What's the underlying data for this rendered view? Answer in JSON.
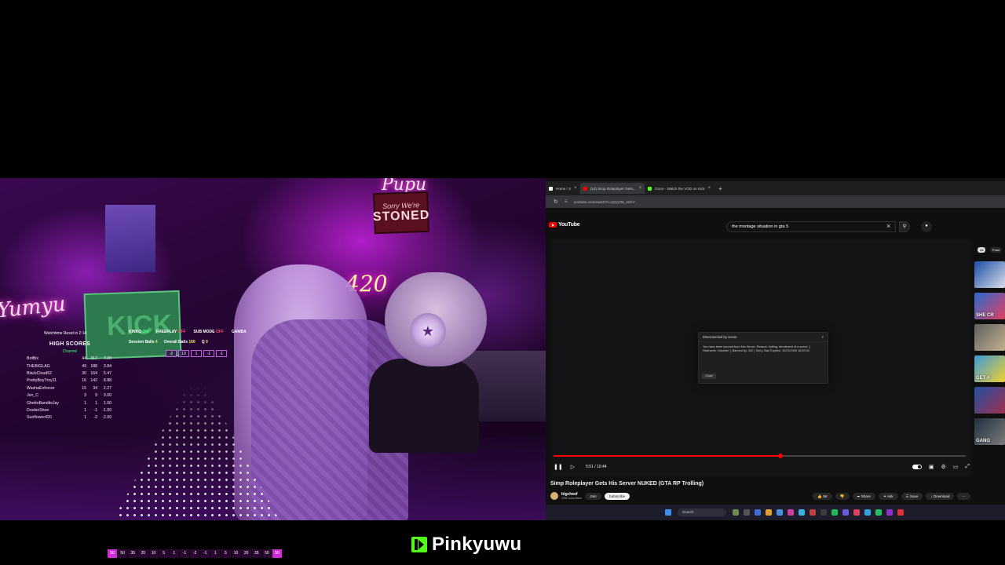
{
  "webcam": {
    "neon_left": "Yumyu",
    "neon_top": "Pupu",
    "neon_420": "420",
    "sign_stoned_top": "Sorry We're",
    "sign_stoned_main": "STONED",
    "kick_card": "KICK"
  },
  "scoreboard": {
    "reset_text": "Watchtime Reset in 2:14",
    "title": "HIGH SCORES",
    "channel": "Channel",
    "rows": [
      {
        "name": "BotBix",
        "a": "44",
        "b": "317",
        "c": "7.20"
      },
      {
        "name": "THEBIGLAG",
        "a": "49",
        "b": "188",
        "c": "3.84"
      },
      {
        "name": "BlackCloud52",
        "a": "30",
        "b": "164",
        "c": "5.47"
      },
      {
        "name": "PrettyBoyTroy11",
        "a": "16",
        "b": "142",
        "c": "8.88"
      },
      {
        "name": "WaxhaEnforcer",
        "a": "15",
        "b": "34",
        "c": "2.27"
      },
      {
        "name": "Jen_C",
        "a": "3",
        "b": "9",
        "c": "3.00"
      },
      {
        "name": "GhettoBanditsJay",
        "a": "1",
        "b": "1",
        "c": "1.00"
      },
      {
        "name": "DookieShoe",
        "a": "1",
        "b": "-1",
        "c": "-1.00"
      },
      {
        "name": "Sunflower420",
        "a": "1",
        "b": "-2",
        "c": "-2.00"
      }
    ]
  },
  "modes": {
    "kinko": "KINKO",
    "kinko_state": "ON",
    "freeplay": "FREEPLAY",
    "freeplay_state": "OFF",
    "submode": "SUB MODE",
    "submode_state": "OFF",
    "gamba": "GAMBA",
    "session_label": "Session Balls",
    "session_value": "4",
    "overall_label": "Overall Balls",
    "overall_value": "160",
    "q_label": "Q",
    "q_value": "0",
    "steps": [
      "-2",
      "10",
      "1",
      "-1",
      "-1"
    ]
  },
  "browser": {
    "tabs": [
      {
        "label": "Home / X",
        "color": "#ffffff"
      },
      {
        "label": "(14) Simp Roleplayer Gets...",
        "color": "#ff0000"
      },
      {
        "label": "Gooo - Watch the VOD on Kick",
        "color": "#53fc18"
      }
    ],
    "url": "youtube.com/watch?v=QGgY5I_4UhY",
    "yt_logo": "YouTube",
    "search_value": "the montage situation in gta 5",
    "ban_dialog": {
      "title": "Disconnected by server",
      "body": "You have been banned from this Server. Reason: trolling, derailment of a scene. [ Nickname: Gambler ], Banned by: 402 | Sorry. Ban Expires: 12/23/2300 16:00:00",
      "button": "Close"
    },
    "time": "5:51 / 10:44",
    "progress": 0.55,
    "video_title": "Simp Roleplayer Gets His Server NUKED (GTA RP Trolling)",
    "channel_name": "bigcheef",
    "channel_subs": "190K subscribers",
    "join": "Join",
    "subscribe": "Subscribe",
    "likes": "5K",
    "share": "Share",
    "ask": "Ask",
    "save": "Save",
    "download": "Download",
    "recs_chips": [
      "All",
      "From"
    ],
    "rec_thumbs": [
      "",
      "SHE CR",
      "",
      "GET A",
      "",
      "GANG"
    ],
    "taskbar_search": "Search"
  },
  "bottom": {
    "score_cells": [
      "50",
      "50",
      "35",
      "20",
      "10",
      "5",
      "1",
      "-1",
      "-2",
      "-1",
      "1",
      "5",
      "10",
      "20",
      "35",
      "50",
      "50"
    ],
    "brand": "Pinkyuwu"
  }
}
